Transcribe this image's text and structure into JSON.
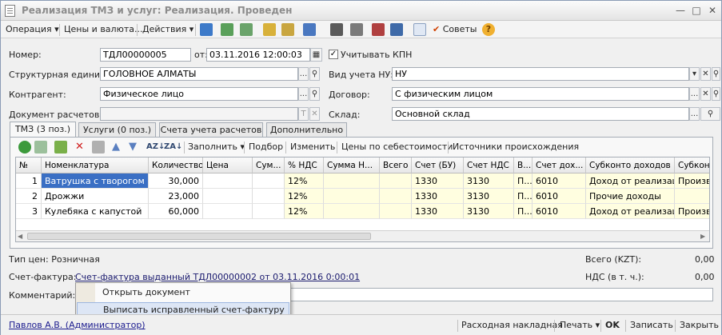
{
  "window": {
    "title": "Реализация ТМЗ и услуг: Реализация. Проведен"
  },
  "toolbar": {
    "operation": "Операция",
    "prices": "Цены и валюта...",
    "actions": "Действия",
    "tips": "Советы",
    "help_glyph": "?"
  },
  "form": {
    "number_label": "Номер:",
    "number_value": "ТДЛ00000005",
    "date_label": "от:",
    "date_value": "03.11.2016 12:00:03",
    "kpn_label": "Учитывать КПН",
    "kpn_checked": "✓",
    "unit_label": "Структурная единица:",
    "unit_value": "ГОЛОВНОЕ АЛМАТЫ",
    "nu_label": "Вид учета НУ:",
    "nu_value": "НУ",
    "contractor_label": "Контрагент:",
    "contractor_value": "Физическое лицо",
    "contract_label": "Договор:",
    "contract_value": "С физическим лицом",
    "settle_doc_label": "Документ расчетов:",
    "settle_doc_value": "",
    "warehouse_label": "Склад:",
    "warehouse_value": "Основной склад"
  },
  "tabs": [
    "ТМЗ (3 поз.)",
    "Услуги (0 поз.)",
    "Счета учета расчетов",
    "Дополнительно"
  ],
  "grid_toolbar": {
    "fill": "Заполнить",
    "pick": "Подбор",
    "change": "Изменить",
    "cost_prices": "Цены по себестоимости",
    "sources": "Источники происхождения"
  },
  "grid": {
    "columns": [
      "№",
      "Номенклатура",
      "Количество",
      "Цена",
      "Сум...",
      "% НДС",
      "Сумма Н...",
      "Всего",
      "Счет (БУ)",
      "Счет НДС",
      "В...",
      "Счет дох...",
      "Субконто доходов ...",
      "Субконт"
    ],
    "rows": [
      [
        "1",
        "Ватрушка с творогом",
        "30,000",
        "",
        "",
        "12%",
        "",
        "",
        "1330",
        "3130",
        "П...",
        "6010",
        "Доход от реализац...",
        "Произв"
      ],
      [
        "2",
        "Дрожжи",
        "23,000",
        "",
        "",
        "12%",
        "",
        "",
        "1330",
        "3130",
        "П...",
        "6010",
        "Прочие доходы",
        ""
      ],
      [
        "3",
        "Кулебяка с капустой",
        "60,000",
        "",
        "",
        "12%",
        "",
        "",
        "1330",
        "3130",
        "П...",
        "6010",
        "Доход от реализац...",
        "Произв"
      ]
    ]
  },
  "footer": {
    "price_type": "Тип цен: Розничная",
    "total_label": "Всего (KZT):",
    "total_value": "0,00",
    "vat_label": "НДС (в т. ч.):",
    "vat_value": "0,00",
    "invoice_label": "Счет-фактура:",
    "invoice_link": "Счет-фактура выданный ТДЛ00000002 от 03.11.2016 0:00:01",
    "comment_label": "Комментарий:"
  },
  "context_menu": {
    "items": [
      "Открыть документ",
      "Выписать исправленный счет-фактуру"
    ]
  },
  "statusbar": {
    "user": "Павлов А.В. (Администратор)",
    "delivery_note": "Расходная накладная",
    "print": "Печать",
    "ok": "OK",
    "save": "Записать",
    "close": "Закрыть"
  }
}
